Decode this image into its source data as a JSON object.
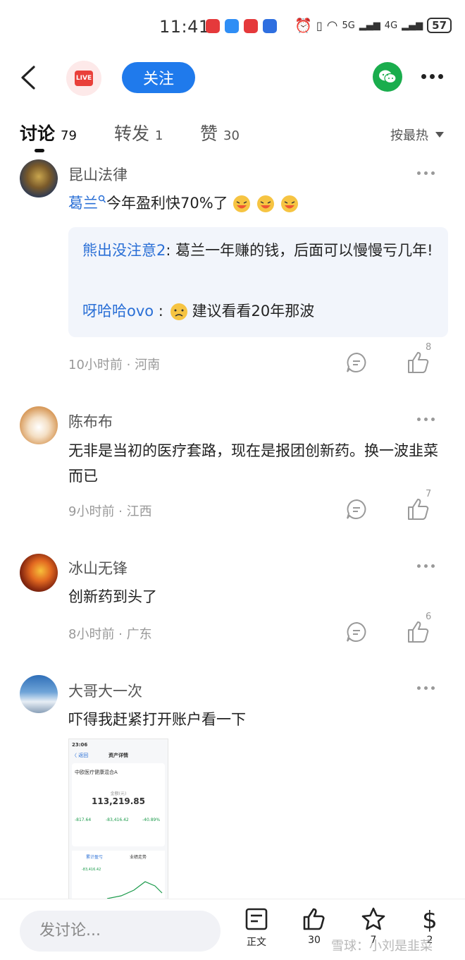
{
  "status": {
    "time": "11:41",
    "signal1": "5G",
    "signal2": "4G",
    "battery": "57"
  },
  "nav": {
    "live_label": "LIVE",
    "follow_label": "关注"
  },
  "tabs": [
    {
      "label": "讨论",
      "count": "79"
    },
    {
      "label": "转发",
      "count": "1"
    },
    {
      "label": "赞",
      "count": "30"
    }
  ],
  "sort_label": "按最热",
  "comments": [
    {
      "author": "昆山法律",
      "mention": "葛兰",
      "text": "今年盈利快70%了",
      "replies": [
        {
          "name": "熊出没注意2",
          "text": ": 葛兰一年赚的钱，后面可以慢慢亏几年!"
        },
        {
          "name": "呀哈哈ovo",
          "text": "建议看看20年那波"
        }
      ],
      "meta": "10小时前 · 河南",
      "likes": "8"
    },
    {
      "author": "陈布布",
      "text": "无非是当初的医疗套路，现在是报团创新药。换一波韭菜而已",
      "meta": "9小时前 · 江西",
      "likes": "7"
    },
    {
      "author": "冰山无锋",
      "text": "创新药到头了",
      "meta": "8小时前 · 广东",
      "likes": "6"
    },
    {
      "author": "大哥大一次",
      "text": "吓得我赶紧打开账户看一下",
      "meta": "",
      "likes": ""
    }
  ],
  "thumbnail": {
    "time": "23:06",
    "title": "资产详情",
    "back": "〈 返回",
    "fund_name": "中欧医疗健康混合A",
    "amount_label": "金额(元)",
    "amount": "113,219.85",
    "stats": [
      "-817.64",
      "-83,416.42",
      "-40.89%"
    ],
    "tab1": "累计盈亏",
    "tab2": "业绩走势",
    "series_value": "-83,416.42"
  },
  "bottom": {
    "input_placeholder": "发讨论...",
    "doc_label": "正文",
    "like_count": "30",
    "star_count": "7",
    "reward_count": "2",
    "watermark": "雪球：小刘是韭菜"
  }
}
